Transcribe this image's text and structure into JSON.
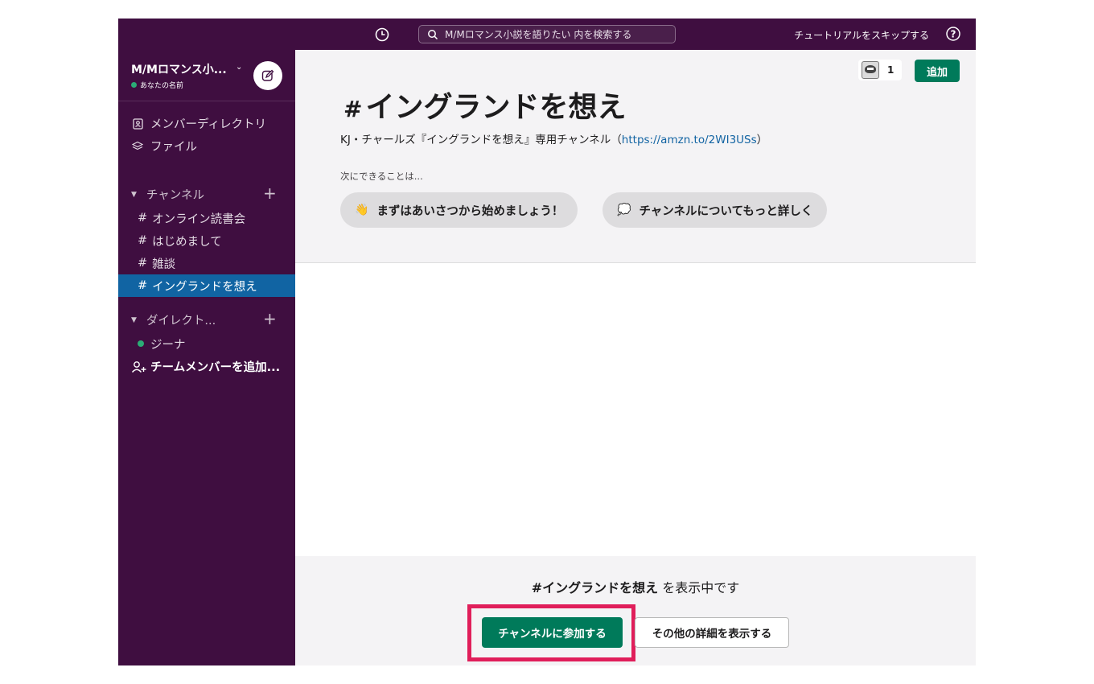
{
  "topbar": {
    "search_placeholder": "M/Mロマンス小説を語りたい 内を検索する",
    "skip_tutorial": "チュートリアルをスキップする"
  },
  "sidebar": {
    "workspace_name": "M/Mロマンス小...",
    "user_name": "あなたの名前",
    "nav": [
      {
        "label": "メンバーディレクトリ",
        "icon": "member-directory-icon"
      },
      {
        "label": "ファイル",
        "icon": "layers-icon"
      }
    ],
    "channels_header": "チャンネル",
    "channels": [
      {
        "name": "オンライン読書会"
      },
      {
        "name": "はじめまして"
      },
      {
        "name": "雑談"
      },
      {
        "name": "イングランドを想え",
        "active": true
      }
    ],
    "dm_header": "ダイレクト...",
    "dms": [
      {
        "name": "ジーナ",
        "status_color": "#2bac76"
      }
    ],
    "add_member": "チームメンバーを追加..."
  },
  "channel": {
    "hash": "#",
    "title": "イングランドを想え",
    "member_count": "1",
    "add_button": "追加",
    "description_text": "KJ・チャールズ『イングランドを想え』専用チャンネル（",
    "description_link": "https://amzn.to/2WI3USs",
    "description_close": "）",
    "next_label": "次にできることは...",
    "suggestions": [
      {
        "emoji": "👋",
        "label": "まずはあいさつから始めましょう！"
      },
      {
        "emoji": "💭",
        "label": "チャンネルについてもっと詳しく"
      }
    ]
  },
  "footer": {
    "viewing_channel": "#イングランドを想え",
    "viewing_suffix": " を表示中です",
    "join_button": "チャンネルに参加する",
    "details_button": "その他の詳細を表示する"
  },
  "colors": {
    "sidebar_bg": "#3f0e40",
    "active_channel": "#1164a3",
    "primary_green": "#007a5a",
    "highlight": "#e01e5a",
    "link": "#1264a3"
  }
}
